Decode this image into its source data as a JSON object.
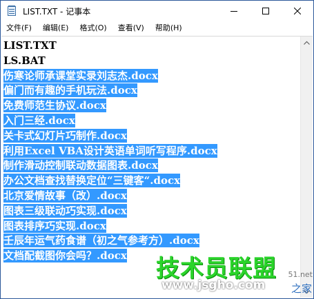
{
  "window": {
    "title": "LIST.TXT - 记事本"
  },
  "menubar": {
    "items": [
      "文件(F)",
      "编辑(E)",
      "格式(O)",
      "查看(V)",
      "帮助(H)"
    ]
  },
  "editor": {
    "lines": [
      {
        "text": "LIST.TXT",
        "selected": false
      },
      {
        "text": "LS.BAT",
        "selected": false
      },
      {
        "text": "伤寒论师承课堂实录刘志杰.docx",
        "selected": true
      },
      {
        "text": "偏门而有趣的手机玩法.docx",
        "selected": true
      },
      {
        "text": "免费师范生协议.docx",
        "selected": true
      },
      {
        "text": "入门三经.docx",
        "selected": true
      },
      {
        "text": "关卡式幻灯片巧制作.docx",
        "selected": true
      },
      {
        "text": "利用Excel VBA设计英语单词听写程序.docx",
        "selected": true
      },
      {
        "text": "制作滑动控制联动数据图表.docx",
        "selected": true
      },
      {
        "text": "办公文档查找替换定位“三键客“.docx",
        "selected": true
      },
      {
        "text": "北京爱情故事（改）.docx",
        "selected": true
      },
      {
        "text": "图表三级联动巧实现.docx",
        "selected": true
      },
      {
        "text": "图表排序巧实现.docx",
        "selected": true
      },
      {
        "text": "壬辰年运气药食谱（初之气参考方）.docx",
        "selected": true
      },
      {
        "text": "文档配截图你会吗？.docx",
        "selected": true
      }
    ]
  },
  "watermark": {
    "logo": "技术员联盟",
    "url": "www.jsgho.com",
    "corner": "51.net",
    "corner2": "之家"
  },
  "colors": {
    "selection": "#3399ff",
    "border": "#2b579a",
    "watermark_green": "#2bd42b"
  },
  "icons": {
    "app": "notepad-icon",
    "minimize": "minimize-icon",
    "maximize": "maximize-icon",
    "close": "close-icon",
    "scroll_up": "chevron-up-icon",
    "scroll_down": "chevron-down-icon"
  }
}
